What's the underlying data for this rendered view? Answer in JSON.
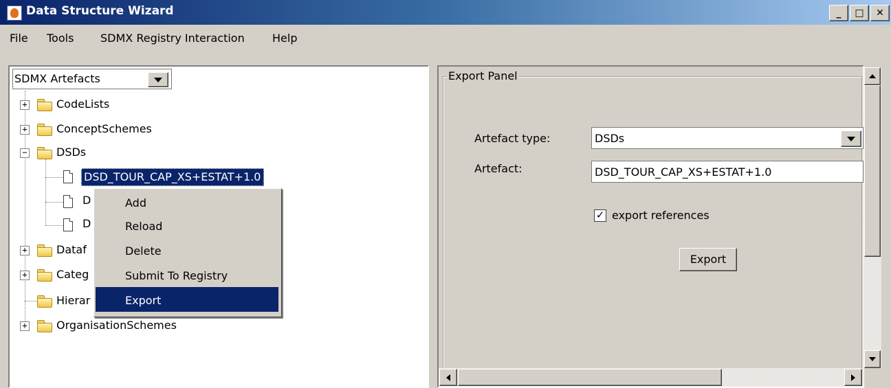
{
  "window": {
    "title": "Data Structure Wizard",
    "minimize": "_",
    "maximize": "□",
    "close": "✕"
  },
  "menu": [
    "File",
    "Tools",
    "SDMX Registry Interaction",
    "Help"
  ],
  "tree": {
    "combo_value": "SDMX Artefacts",
    "nodes": [
      {
        "label": "CodeLists",
        "expander": "+"
      },
      {
        "label": "ConceptSchemes",
        "expander": "+"
      },
      {
        "label": "DSDs",
        "expander": "−"
      },
      {
        "label": "DSD_TOUR_CAP_XS+ESTAT+1.0"
      },
      {
        "label": "D"
      },
      {
        "label": "D"
      },
      {
        "label": "Dataf",
        "expander": "+"
      },
      {
        "label": "Categ",
        "expander": "+"
      },
      {
        "label": "Hierar"
      },
      {
        "label": "OrganisationSchemes",
        "expander": "+"
      }
    ]
  },
  "context_menu": [
    "Add",
    "Reload",
    "Delete",
    "Submit To Registry",
    "Export"
  ],
  "export_panel": {
    "title": "Export Panel",
    "artefact_type_label": "Artefact type:",
    "artefact_type_value": "DSDs",
    "artefact_label": "Artefact:",
    "artefact_value": "DSD_TOUR_CAP_XS+ESTAT+1.0",
    "export_references_label": "export references",
    "export_references_checked": "✓",
    "export_button": "Export"
  },
  "colors": {
    "selection": "#0a246a",
    "face": "#d4d0c8"
  }
}
